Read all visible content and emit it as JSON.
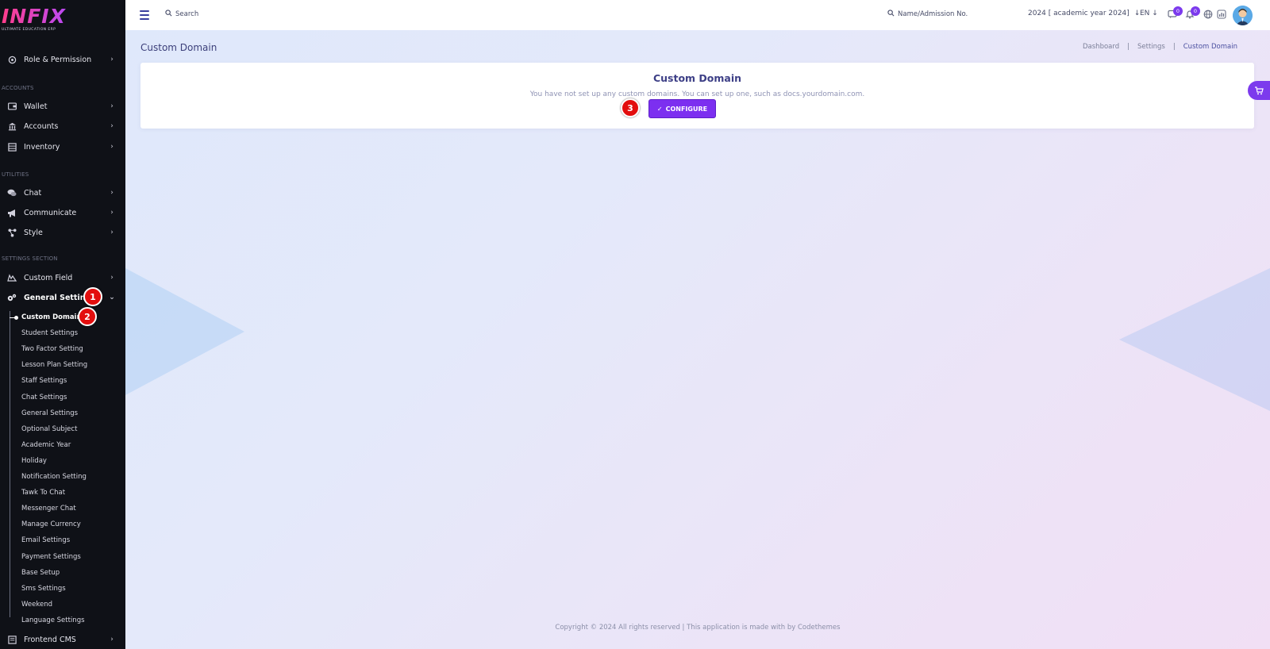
{
  "brand": {
    "logo_text": "INFIX",
    "tagline": "ULTIMATE EDUCATION ERP"
  },
  "sidebar": {
    "items_top": [
      {
        "label": "Role & Permission",
        "icon": "role-icon"
      }
    ],
    "sections": {
      "accounts": "ACCOUNTS",
      "utilities": "UTILITIES",
      "settings": "SETTINGS SECTION"
    },
    "accounts_items": [
      {
        "label": "Wallet",
        "icon": "wallet-icon"
      },
      {
        "label": "Accounts",
        "icon": "bank-icon"
      },
      {
        "label": "Inventory",
        "icon": "inventory-icon"
      }
    ],
    "utilities_items": [
      {
        "label": "Chat",
        "icon": "chat-icon"
      },
      {
        "label": "Communicate",
        "icon": "megaphone-icon"
      },
      {
        "label": "Style",
        "icon": "style-icon"
      }
    ],
    "settings_items": [
      {
        "label": "Custom Field",
        "icon": "custom-field-icon"
      },
      {
        "label": "General Settings",
        "icon": "gears-icon"
      }
    ],
    "general_settings_sub": [
      "Custom Domain",
      "Student Settings",
      "Two Factor Setting",
      "Lesson Plan Setting",
      "Staff Settings",
      "Chat Settings",
      "General Settings",
      "Optional Subject",
      "Academic Year",
      "Holiday",
      "Notification Setting",
      "Tawk To Chat",
      "Messenger Chat",
      "Manage Currency",
      "Email Settings",
      "Payment Settings",
      "Base Setup",
      "Sms Settings",
      "Weekend",
      "Language Settings"
    ],
    "bottom_item": {
      "label": "Frontend CMS",
      "icon": "cms-icon"
    }
  },
  "annotations": {
    "badge1": "1",
    "badge2": "2",
    "badge3": "3"
  },
  "topbar": {
    "search_placeholder": "Search",
    "student_search": "Name/Admission No.",
    "academic_year": "2024 [ academic year 2024]",
    "language": "EN",
    "message_count": "0",
    "notification_count": "0"
  },
  "page": {
    "title": "Custom Domain",
    "breadcrumbs": [
      "Dashboard",
      "Settings",
      "Custom Domain"
    ],
    "card_title": "Custom Domain",
    "card_description": "You have not set up any custom domains. You can set up one, such as docs.yourdomain.com.",
    "configure_label": "CONFIGURE"
  },
  "footer": {
    "text": "Copyright © 2024 All rights reserved | This application is made with by Codethemes"
  },
  "colors": {
    "accent": "#7c2ff0",
    "sidebar_bg": "#0f1117",
    "badge": "#e30e0e"
  }
}
